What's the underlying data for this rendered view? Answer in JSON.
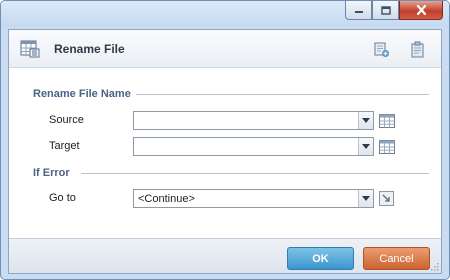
{
  "window": {
    "controls": [
      "minimize-icon",
      "maximize-icon",
      "close-icon"
    ]
  },
  "header": {
    "title": "Rename File",
    "icons": [
      "table-icon",
      "add-document-icon",
      "clipboard-icon"
    ]
  },
  "sections": {
    "rename": {
      "label": "Rename File Name"
    },
    "error": {
      "label": "If Error"
    }
  },
  "fields": {
    "source": {
      "label": "Source",
      "value": ""
    },
    "target": {
      "label": "Target",
      "value": ""
    },
    "goto": {
      "label": "Go to",
      "value": "<Continue>"
    }
  },
  "footer": {
    "ok_label": "OK",
    "cancel_label": "Cancel"
  },
  "colors": {
    "ok": "#3b96cd",
    "cancel": "#cc6330",
    "section_label": "#4a6384",
    "frame": "#c9dcf1"
  }
}
